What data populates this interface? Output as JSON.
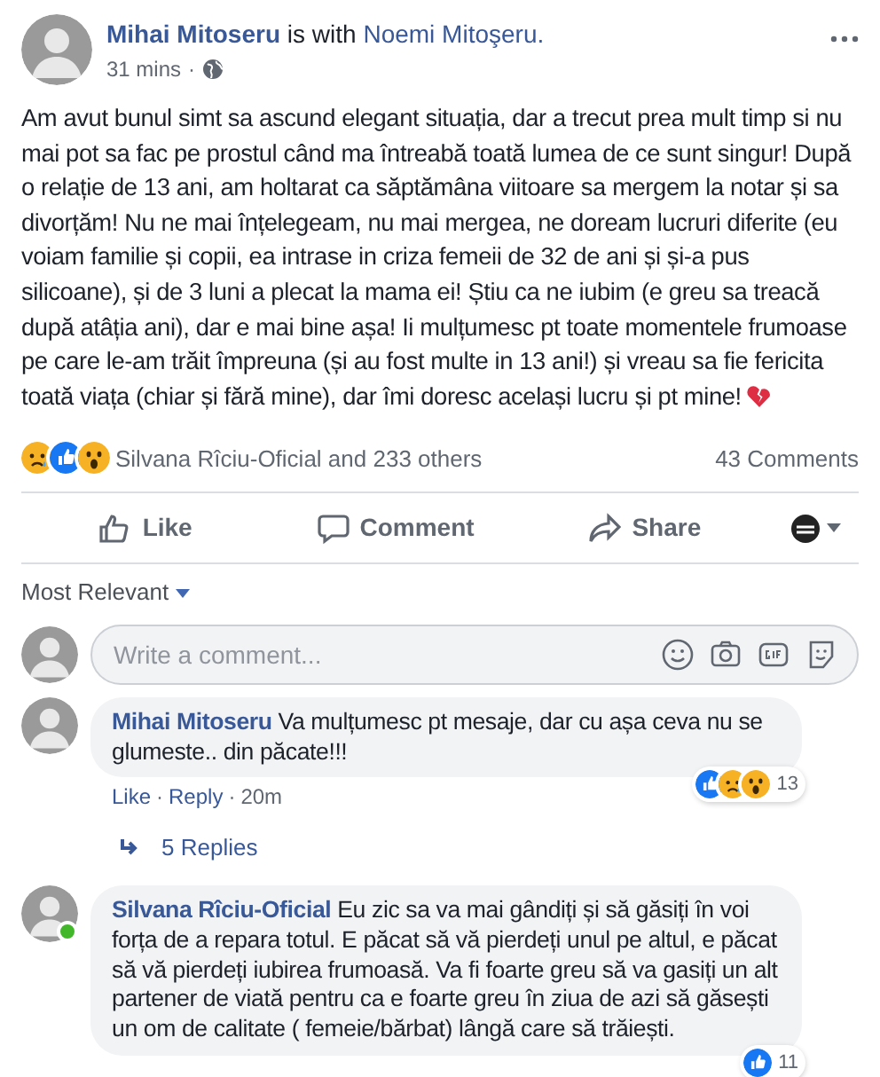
{
  "post": {
    "author": "Mihai Mitoseru",
    "with_text": "is with",
    "tagged": "Noemi Mitoşeru.",
    "time": "31 mins",
    "separator": "·",
    "body": "Am avut bunul simt sa ascund elegant situația, dar a trecut prea mult timp si nu mai pot sa fac pe prostul când ma întreabă toată lumea de ce sunt singur! După o relație de 13 ani, am holtarat ca săptămâna viitoare sa mergem la notar și sa divorțăm! Nu ne mai înțelegeam, nu mai mergea, ne doream lucruri diferite (eu voiam familie și copii, ea intrase in criza femeii de 32 de ani și și-a pus silicoane), și de 3 luni a plecat la mama ei! Știu ca ne iubim (e greu sa treacă după atâția ani), dar e mai bine așa! Ii mulțumesc pt toate momentele frumoase pe care le-am trăit împreuna (și au fost multe in 13 ani!) și vreau sa fie fericita toată viața (chiar și fără mine), dar îmi doresc același lucru și pt mine!"
  },
  "reactions": {
    "summary": "Silvana Rîciu-Oficial and 233 others",
    "comments_count": "43 Comments",
    "icons": [
      {
        "kind": "sad"
      },
      {
        "kind": "like"
      },
      {
        "kind": "wow"
      }
    ]
  },
  "actions": [
    {
      "kind": "like",
      "label": "Like"
    },
    {
      "kind": "comment",
      "label": "Comment"
    },
    {
      "kind": "share",
      "label": "Share"
    }
  ],
  "sort": {
    "label": "Most Relevant"
  },
  "composer": {
    "placeholder": "Write a comment..."
  },
  "comments": [
    {
      "author": "Mihai Mitoseru",
      "text": "Va mulțumesc pt mesaje, dar cu așa ceva nu se glumeste.. din păcate!!!",
      "online": false,
      "links": [
        "Like",
        "Reply",
        "20m"
      ],
      "link_separator": "·",
      "reactions": [
        {
          "kind": "like"
        },
        {
          "kind": "sad"
        },
        {
          "kind": "wow"
        }
      ],
      "reaction_count": "13",
      "replies": "5 Replies"
    },
    {
      "author": "Silvana Rîciu-Oficial",
      "text": "Eu zic sa va mai gândiți și să găsiți în voi forța de a repara totul. E păcat să vă pierdeți unul pe altul, e păcat să vă pierdeți iubirea frumoasă. Va fi foarte greu să va gasiți un alt partener de viată pentru ca e foarte greu în ziua de azi să găsești un om de calitate ( femeie/bărbat) lângă care să trăiești.",
      "online": true,
      "reactions": [
        {
          "kind": "like"
        }
      ],
      "reaction_count": "11"
    }
  ]
}
